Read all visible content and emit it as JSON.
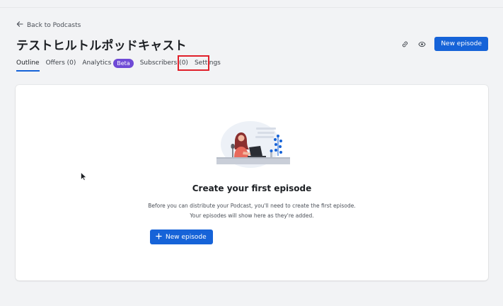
{
  "back_link": {
    "label": "Back to Podcasts",
    "icon": "arrow-left-icon"
  },
  "page": {
    "title": "テストヒルトルポッドキャスト"
  },
  "header_actions": {
    "link_icon": "link-icon",
    "preview_icon": "eye-icon",
    "new_episode_label": "New episode"
  },
  "tabs": [
    {
      "label": "Outline",
      "active": true
    },
    {
      "label": "Offers (0)"
    },
    {
      "label": "Analytics",
      "badge": "Beta"
    },
    {
      "label": "Subscribers (0)"
    },
    {
      "label": "Settings",
      "highlighted": true
    }
  ],
  "empty_state": {
    "title": "Create your first episode",
    "desc_line1": "Before you can distribute your Podcast, you'll need to create the first episode.",
    "desc_line2": "Your episodes will show here as they're added.",
    "button_label": "New episode",
    "button_icon": "plus-icon"
  },
  "colors": {
    "primary": "#1663d8",
    "beta_badge": "#6f4ad6",
    "highlight": "#e0202a",
    "background": "#f2f3f5"
  }
}
